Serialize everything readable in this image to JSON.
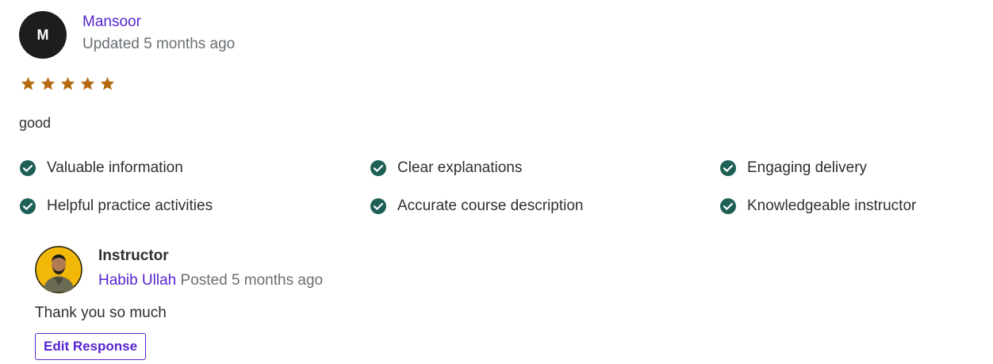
{
  "review": {
    "avatar_initial": "M",
    "reviewer_name": "Mansoor",
    "updated": "Updated 5 months ago",
    "rating": 5,
    "star_color": "#b4690e",
    "text": "good",
    "tags": [
      "Valuable information",
      "Clear explanations",
      "Engaging delivery",
      "Helpful practice activities",
      "Accurate course description",
      "Knowledgeable instructor"
    ],
    "tag_check_color": "#1e6055"
  },
  "response": {
    "role": "Instructor",
    "instructor_name": "Habib Ullah",
    "posted": "Posted 5 months ago",
    "text": "Thank you so much",
    "edit_label": "Edit Response",
    "accent_color": "#5624d0"
  }
}
